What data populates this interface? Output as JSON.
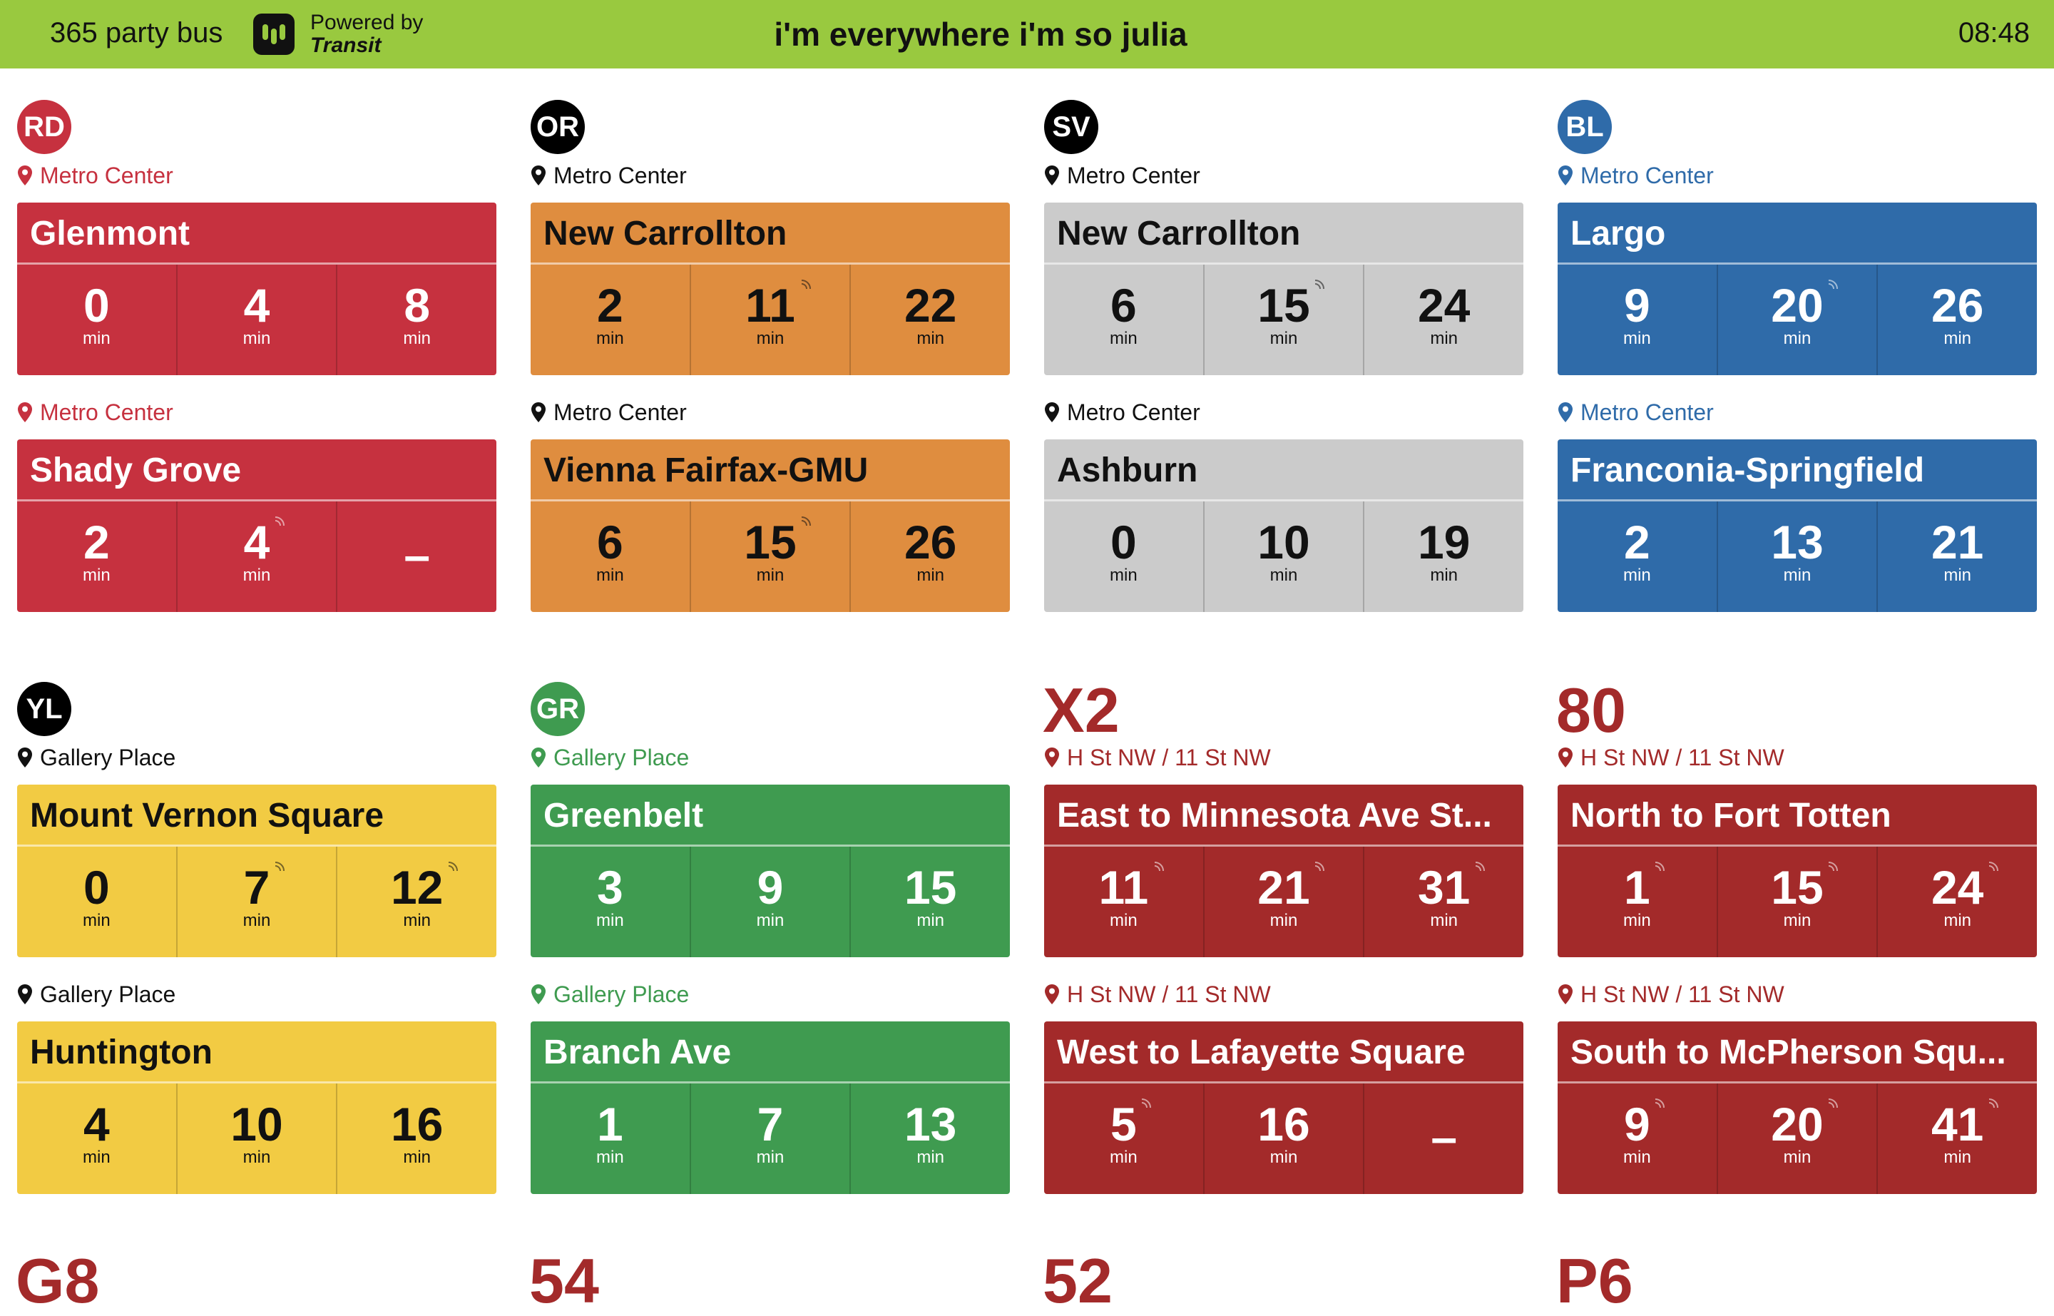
{
  "header": {
    "app_name": "365 party bus",
    "powered_line1": "Powered by",
    "powered_line2": "Transit",
    "title": "i'm everywhere i'm so julia",
    "time": "08:48"
  },
  "colors": {
    "header_bg": "#99c93f",
    "red_line": "#c6313f",
    "orange_line": "#df8d3f",
    "silver_line": "#cbcbcb",
    "blue_line": "#2f6ba9",
    "yellow_line": "#f2cb43",
    "green_line": "#3f9b50",
    "bus": "#a32a2a"
  },
  "unit": "min",
  "sections": [
    {
      "badge": "RD",
      "route": "",
      "badge_bg": "#c6313f",
      "badge_text": "#ffffff",
      "stop_color": "#c6313f",
      "card_bg": "#c6313f",
      "card_text": "#ffffff",
      "rule": "#ffffff",
      "directions": [
        {
          "stop": "Metro Center",
          "dest": "Glenmont",
          "times": [
            "0",
            "4",
            "8"
          ],
          "realtime": [
            false,
            false,
            false
          ]
        },
        {
          "stop": "Metro Center",
          "dest": "Shady Grove",
          "times": [
            "2",
            "4",
            "–"
          ],
          "realtime": [
            false,
            true,
            false
          ]
        }
      ]
    },
    {
      "badge": "OR",
      "route": "",
      "badge_bg": "#000000",
      "badge_text": "#ffffff",
      "stop_color": "#111111",
      "card_bg": "#df8d3f",
      "card_text": "#111111",
      "rule": "#ffffff",
      "directions": [
        {
          "stop": "Metro Center",
          "dest": "New Carrollton",
          "times": [
            "2",
            "11",
            "22"
          ],
          "realtime": [
            false,
            true,
            false
          ]
        },
        {
          "stop": "Metro Center",
          "dest": "Vienna Fairfax-GMU",
          "times": [
            "6",
            "15",
            "26"
          ],
          "realtime": [
            false,
            true,
            false
          ]
        }
      ]
    },
    {
      "badge": "SV",
      "route": "",
      "badge_bg": "#000000",
      "badge_text": "#ffffff",
      "stop_color": "#111111",
      "card_bg": "#cbcbcb",
      "card_text": "#111111",
      "rule": "#ffffff",
      "directions": [
        {
          "stop": "Metro Center",
          "dest": "New Carrollton",
          "times": [
            "6",
            "15",
            "24"
          ],
          "realtime": [
            false,
            true,
            false
          ]
        },
        {
          "stop": "Metro Center",
          "dest": "Ashburn",
          "times": [
            "0",
            "10",
            "19"
          ],
          "realtime": [
            false,
            false,
            false
          ]
        }
      ]
    },
    {
      "badge": "BL",
      "route": "",
      "badge_bg": "#2f6ba9",
      "badge_text": "#ffffff",
      "stop_color": "#2f6ba9",
      "card_bg": "#2f6ba9",
      "card_text": "#ffffff",
      "rule": "#ffffff",
      "directions": [
        {
          "stop": "Metro Center",
          "dest": "Largo",
          "times": [
            "9",
            "20",
            "26"
          ],
          "realtime": [
            false,
            true,
            false
          ]
        },
        {
          "stop": "Metro Center",
          "dest": "Franconia-Springfield",
          "times": [
            "2",
            "13",
            "21"
          ],
          "realtime": [
            false,
            false,
            false
          ]
        }
      ]
    },
    {
      "badge": "YL",
      "route": "",
      "badge_bg": "#000000",
      "badge_text": "#ffffff",
      "stop_color": "#111111",
      "card_bg": "#f2cb43",
      "card_text": "#111111",
      "rule": "#ffffff",
      "directions": [
        {
          "stop": "Gallery Place",
          "dest": "Mount Vernon Square",
          "times": [
            "0",
            "7",
            "12"
          ],
          "realtime": [
            false,
            true,
            true
          ]
        },
        {
          "stop": "Gallery Place",
          "dest": "Huntington",
          "times": [
            "4",
            "10",
            "16"
          ],
          "realtime": [
            false,
            false,
            false
          ]
        }
      ]
    },
    {
      "badge": "GR",
      "route": "",
      "badge_bg": "#3f9b50",
      "badge_text": "#ffffff",
      "stop_color": "#3f9b50",
      "card_bg": "#3f9b50",
      "card_text": "#ffffff",
      "rule": "#ffffff",
      "directions": [
        {
          "stop": "Gallery Place",
          "dest": "Greenbelt",
          "times": [
            "3",
            "9",
            "15"
          ],
          "realtime": [
            false,
            false,
            false
          ]
        },
        {
          "stop": "Gallery Place",
          "dest": "Branch Ave",
          "times": [
            "1",
            "7",
            "13"
          ],
          "realtime": [
            false,
            false,
            false
          ]
        }
      ]
    },
    {
      "badge": "",
      "route": "X2",
      "badge_bg": "",
      "badge_text": "#a32a2a",
      "stop_color": "#a32a2a",
      "card_bg": "#a32a2a",
      "card_text": "#ffffff",
      "rule": "#ffffff",
      "directions": [
        {
          "stop": "H St NW / 11 St NW",
          "dest": "East to Minnesota Ave St...",
          "times": [
            "11",
            "21",
            "31"
          ],
          "realtime": [
            true,
            true,
            true
          ]
        },
        {
          "stop": "H St NW / 11 St NW",
          "dest": "West to Lafayette Square",
          "times": [
            "5",
            "16",
            "–"
          ],
          "realtime": [
            true,
            false,
            false
          ]
        }
      ]
    },
    {
      "badge": "",
      "route": "80",
      "badge_bg": "",
      "badge_text": "#a32a2a",
      "stop_color": "#a32a2a",
      "card_bg": "#a32a2a",
      "card_text": "#ffffff",
      "rule": "#ffffff",
      "directions": [
        {
          "stop": "H St NW / 11 St NW",
          "dest": "North to Fort Totten",
          "times": [
            "1",
            "15",
            "24"
          ],
          "realtime": [
            true,
            true,
            true
          ]
        },
        {
          "stop": "H St NW / 11 St NW",
          "dest": "South to McPherson Squ...",
          "times": [
            "9",
            "20",
            "41"
          ],
          "realtime": [
            true,
            true,
            true
          ]
        }
      ]
    }
  ],
  "partial_routes": [
    "G8",
    "54",
    "52",
    "P6"
  ]
}
